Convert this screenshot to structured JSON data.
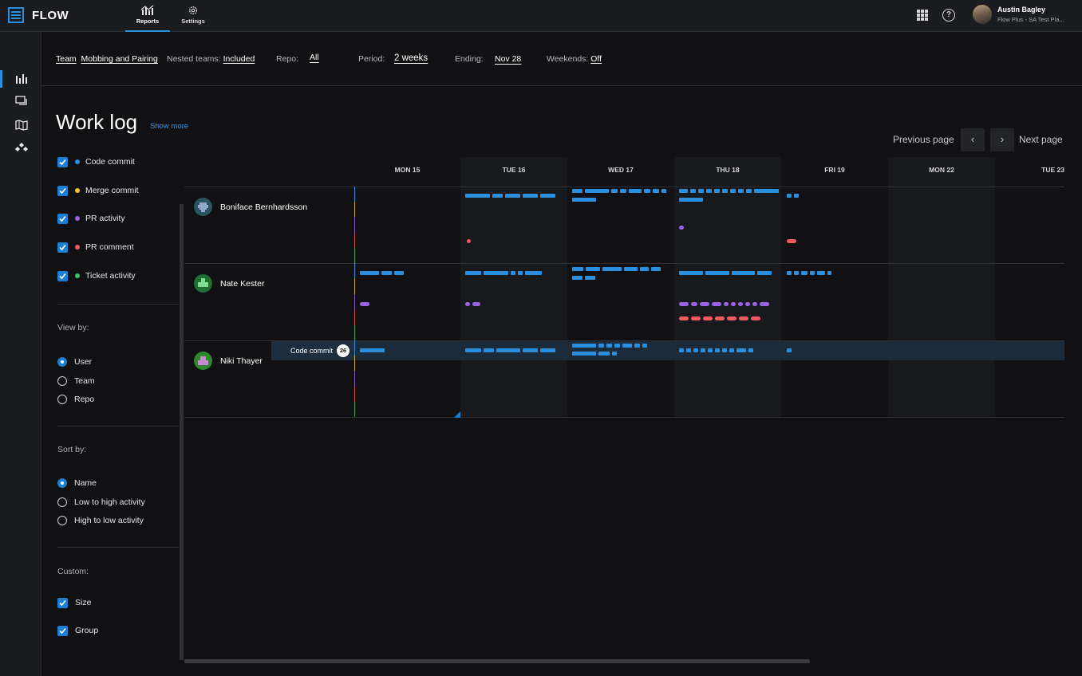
{
  "app": {
    "logo_text": "FLOW"
  },
  "topnav": {
    "tabs": [
      {
        "label": "Reports"
      },
      {
        "label": "Settings"
      }
    ]
  },
  "user": {
    "name": "Austin Bagley",
    "subtitle": "Flow Plus - SA Test Pla..."
  },
  "filterbar": {
    "team_label": "Team",
    "team_value": "Mobbing and Pairing",
    "nested_label": "Nested teams:",
    "nested_value": "Included",
    "repo_label": "Repo:",
    "repo_value": "All",
    "period_label": "Period:",
    "period_value": "2 weeks",
    "ending_label": "Ending:",
    "ending_value": "Nov 28",
    "weekends_label": "Weekends:",
    "weekends_value": "Off"
  },
  "page": {
    "title": "Work log",
    "show_more": "Show more"
  },
  "pager": {
    "prev_label": "Previous page",
    "next_label": "Next page"
  },
  "legend": [
    {
      "label": "Code commit",
      "color": "#2b8fe0"
    },
    {
      "label": "Merge commit",
      "color": "#f2c230"
    },
    {
      "label": "PR activity",
      "color": "#9a63e6"
    },
    {
      "label": "PR comment",
      "color": "#f05a5f"
    },
    {
      "label": "Ticket activity",
      "color": "#35c46a"
    }
  ],
  "view_by": {
    "label": "View by:",
    "options": [
      "User",
      "Team",
      "Repo"
    ],
    "selected": "User"
  },
  "sort_by": {
    "label": "Sort by:",
    "options": [
      "Name",
      "Low to high activity",
      "High to low activity"
    ],
    "selected": "Name"
  },
  "custom": {
    "label": "Custom:",
    "options": [
      "Size",
      "Group"
    ]
  },
  "days": [
    "MON 15",
    "TUE 16",
    "WED 17",
    "THU 18",
    "FRI 19",
    "MON 22",
    "TUE 23"
  ],
  "users": [
    {
      "name": "Boniface Bernhardsson"
    },
    {
      "name": "Nate Kester"
    },
    {
      "name": "Niki Thayer"
    }
  ],
  "tooltip": {
    "label": "Code commit",
    "count": "26"
  }
}
